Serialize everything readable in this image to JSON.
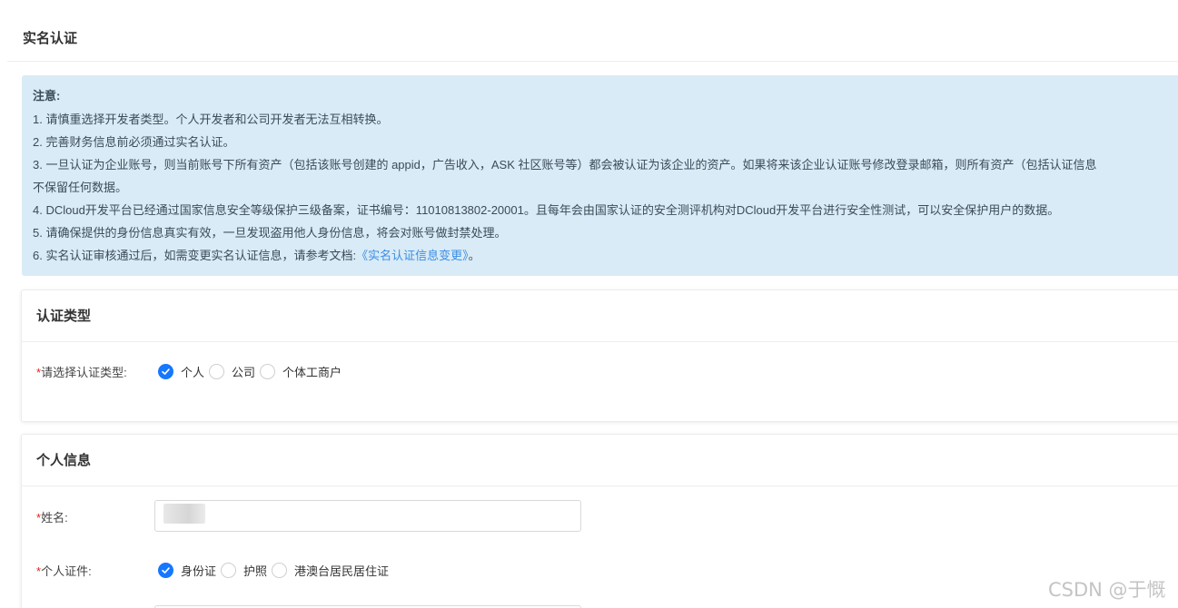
{
  "page": {
    "title": "实名认证"
  },
  "notice": {
    "heading": "注意:",
    "lines": [
      "1. 请慎重选择开发者类型。个人开发者和公司开发者无法互相转换。",
      "2. 完善财务信息前必须通过实名认证。",
      "3. 一旦认证为企业账号，则当前账号下所有资产（包括该账号创建的 appid，广告收入，ASK 社区账号等）都会被认证为该企业的资产。如果将来该企业认证账号修改登录邮箱，则所有资产（包括认证信息",
      "不保留任何数据。",
      "4. DCloud开发平台已经通过国家信息安全等级保护三级备案，证书编号：11010813802-20001。且每年会由国家认证的安全测评机构对DCloud开发平台进行安全性测试，可以安全保护用户的数据。",
      "5. 请确保提供的身份信息真实有效，一旦发现盗用他人身份信息，将会对账号做封禁处理。"
    ],
    "line6_prefix": "6. 实名认证审核通过后，如需变更实名认证信息，请参考文档:",
    "line6_link": "《实名认证信息变更》",
    "line6_suffix": "。"
  },
  "auth_type": {
    "section_title": "认证类型",
    "required_mark": "*",
    "label": "请选择认证类型:",
    "options": [
      "个人",
      "公司",
      "个体工商户"
    ],
    "selected": "个人"
  },
  "personal": {
    "section_title": "个人信息",
    "name_required_mark": "*",
    "name_label": "姓名:",
    "id_required_mark": "*",
    "id_label": "个人证件:",
    "id_options": [
      "身份证",
      "护照",
      "港澳台居民居住证"
    ],
    "id_selected": "身份证"
  },
  "watermark": "CSDN @于慨",
  "colors": {
    "accent": "#1677ff",
    "notice_bg": "#d9ebf6",
    "required": "#e2231a",
    "link": "#3a8ee6"
  }
}
